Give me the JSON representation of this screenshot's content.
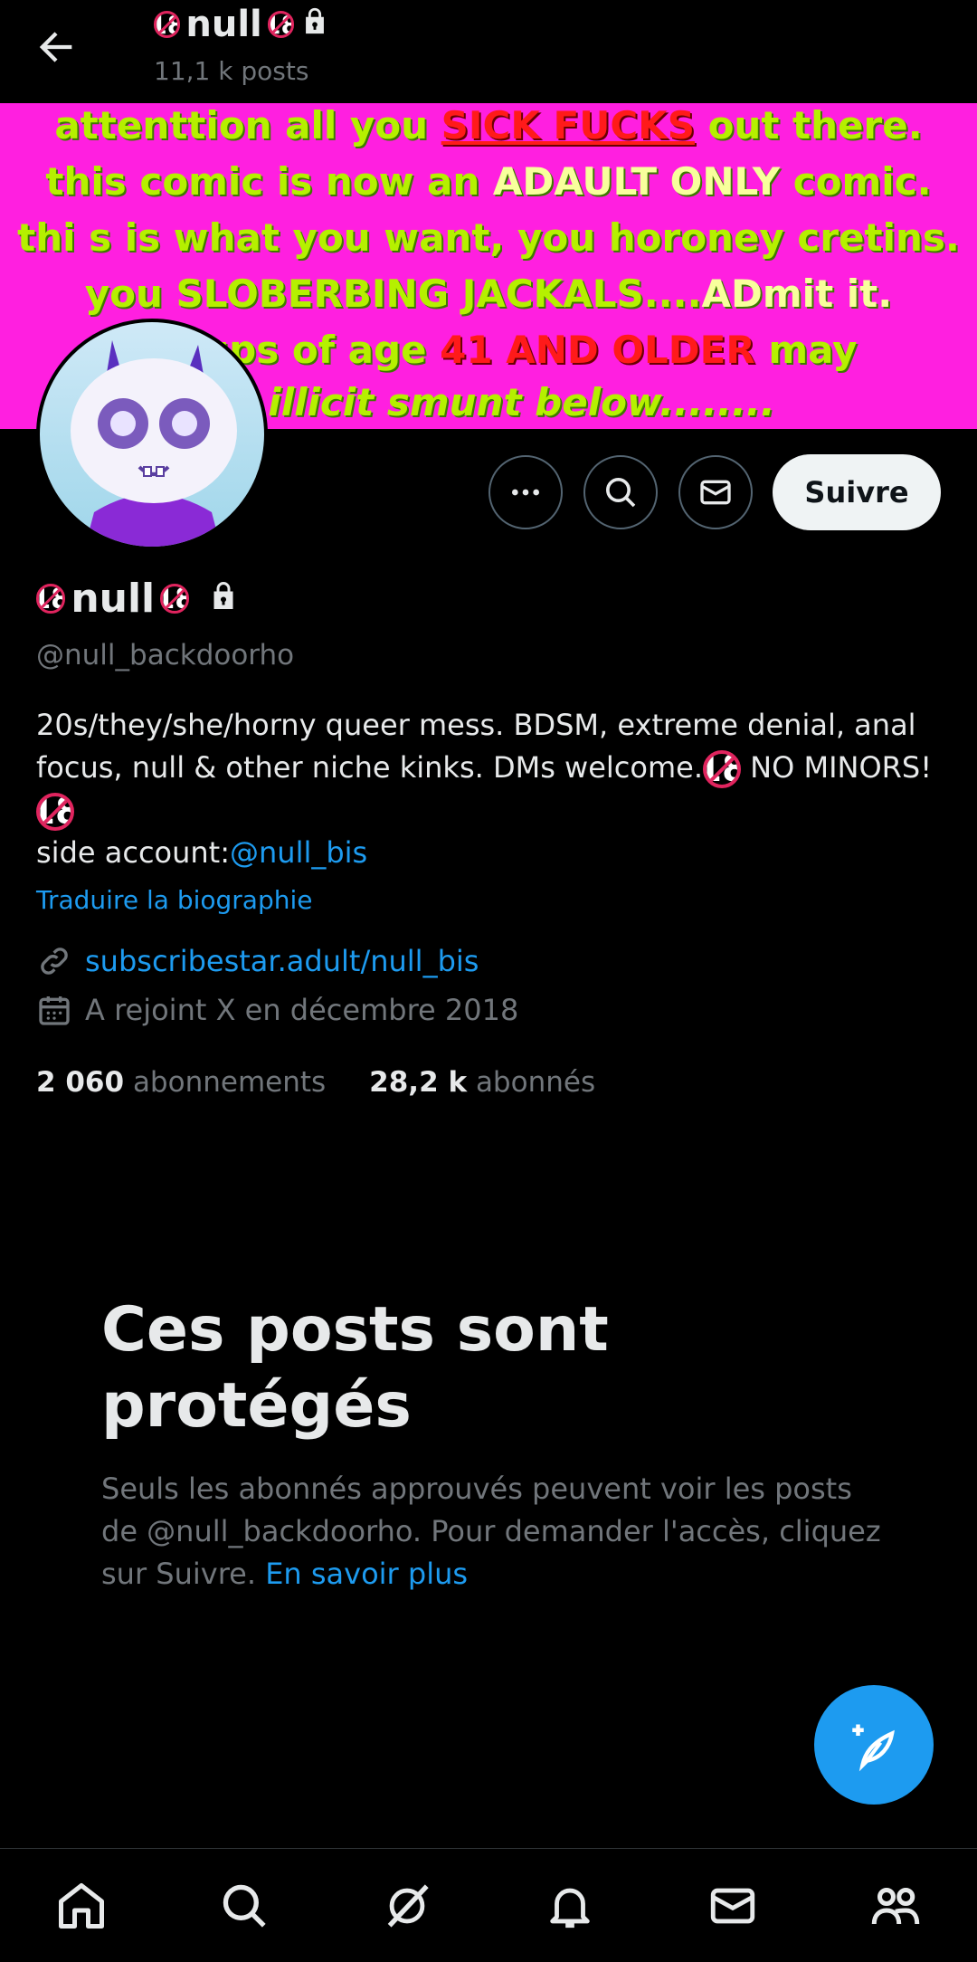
{
  "header": {
    "title": "null",
    "posts_count": "11,1 k posts"
  },
  "banner": {
    "line1a": "attenttion all you ",
    "line1b": "SICK FUCKS",
    "line1c": " out there.",
    "line2a": "this comic is now an ",
    "line2b": "ADAULT ONLY",
    "line2c": " comic.",
    "line3": "thi s is what you want, you horoney cretins.",
    "line4a": "you SLOBERBING JACKALS....",
    "line4b": "ADmit it.",
    "line5a": "o     n-ups of age ",
    "line5b": "41 AND OLDER",
    "line5c": " may",
    "line6": "he illicit smunt below........"
  },
  "actions": {
    "follow_label": "Suivre"
  },
  "profile": {
    "name": "null",
    "handle": "@null_backdoorho",
    "bio_line1": "20s/they/she/horny queer mess. BDSM, extreme denial, anal focus, null & other niche kinks. DMs welcome.",
    "bio_no_minors": " NO MINORS!",
    "side_account_label": "side account:",
    "side_account_link": "@null_bis",
    "translate_bio": "Traduire la biographie",
    "website": "subscribestar.adult/null_bis",
    "joined": "A rejoint X en décembre 2018",
    "following_count": "2 060",
    "following_label": "abonnements",
    "followers_count": "28,2 k",
    "followers_label": "abonnés"
  },
  "protected": {
    "title": "Ces posts sont protégés",
    "desc": "Seuls les abonnés approuvés peuvent voir les posts de @null_backdoorho. Pour demander l'accès, cliquez sur Suivre. ",
    "learn_more": "En savoir plus"
  },
  "badge_text": "18",
  "colors": {
    "accent": "#1d9bf0",
    "banner_bg": "#ff1fe0",
    "banner_text": "#b5f000",
    "badge_red": "#e0245e"
  },
  "icons": [
    "back-arrow-icon",
    "lock-icon",
    "more-icon",
    "search-icon",
    "mail-icon",
    "link-icon",
    "calendar-icon",
    "compose-icon",
    "home-icon",
    "grok-icon",
    "bell-icon",
    "communities-icon"
  ]
}
